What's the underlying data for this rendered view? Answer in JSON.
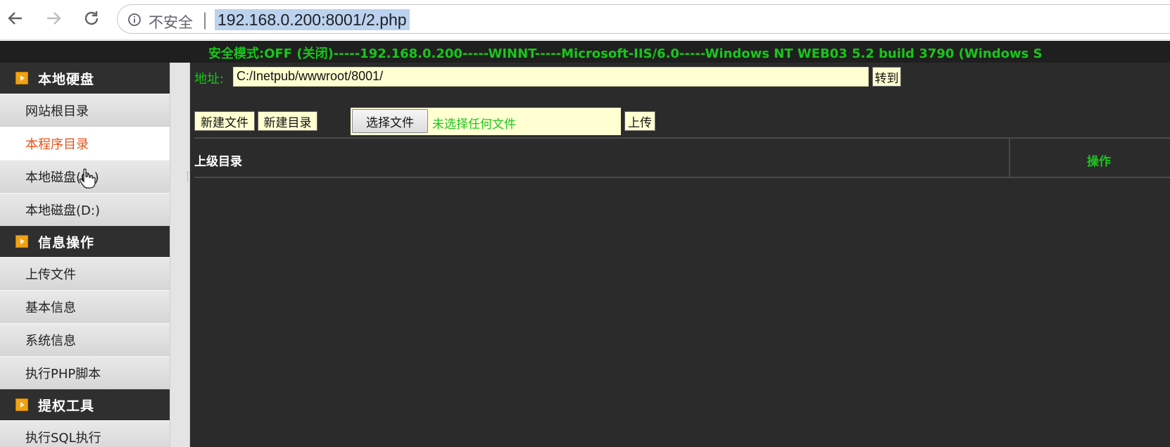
{
  "browser": {
    "security_label": "不安全",
    "separator": "|",
    "url": "192.168.0.200:8001/2.php"
  },
  "banner": {
    "text": "安全模式:OFF (关闭)-----192.168.0.200-----WINNT-----Microsoft-IIS/6.0-----Windows NT WEB03 5.2 build 3790 (Windows S"
  },
  "sidebar": {
    "sections": [
      {
        "title": "本地硬盘",
        "items": [
          {
            "label": "网站根目录"
          },
          {
            "label": "本程序目录",
            "active": true
          },
          {
            "label": "本地磁盘(C:)"
          },
          {
            "label": "本地磁盘(D:)"
          }
        ]
      },
      {
        "title": "信息操作",
        "items": [
          {
            "label": "上传文件"
          },
          {
            "label": "基本信息"
          },
          {
            "label": "系统信息"
          },
          {
            "label": "执行PHP脚本"
          }
        ]
      },
      {
        "title": "提权工具",
        "items": [
          {
            "label": "执行SQL执行"
          }
        ]
      }
    ]
  },
  "main": {
    "address_label": "地址:",
    "address_value": "C:/Inetpub/wwwroot/8001/",
    "goto_label": "转到",
    "new_file_label": "新建文件",
    "new_dir_label": "新建目录",
    "choose_file_label": "选择文件",
    "no_file_label": "未选择任何文件",
    "upload_label": "上传",
    "table": {
      "col_parent": "上级目录",
      "col_operation": "操作"
    }
  },
  "colors": {
    "accent_green": "#19c61b",
    "active_orange": "#e8531b",
    "input_bg": "#ffffd2",
    "page_bg": "#2b2b2b"
  }
}
